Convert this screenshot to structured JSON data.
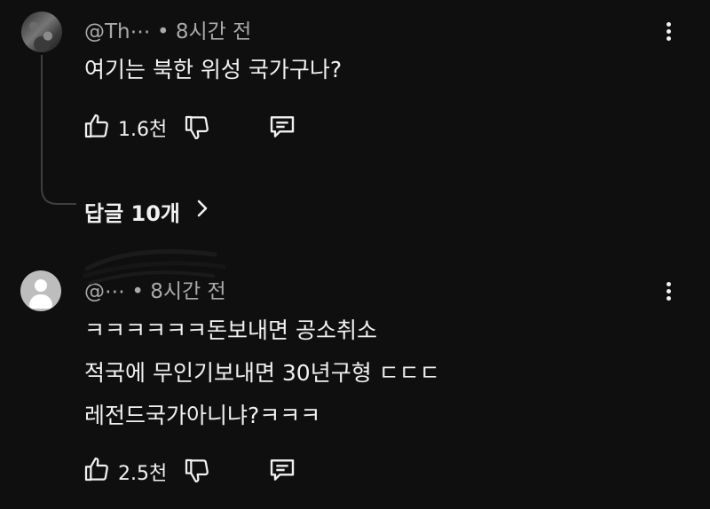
{
  "comments": [
    {
      "author": "@Th⋯",
      "time": "• 8시간 전",
      "lines": [
        "여기는  북한 위성 국가구나?"
      ],
      "likes": "1.6천",
      "replies_label": "답글 10개",
      "avatar": "photo-avatar"
    },
    {
      "author": "@⋯",
      "time": "• 8시간 전",
      "lines": [
        "ㅋㅋㅋㅋㅋㅋ돈보내면 공소취소",
        "적국에 무인기보내면 30년구형 ㄷㄷㄷ",
        "레전드국가아니냐?ㅋㅋㅋ"
      ],
      "likes": "2.5천",
      "avatar": "default-avatar"
    }
  ],
  "icons": {
    "like": "thumbs-up-icon",
    "dislike": "thumbs-down-icon",
    "reply": "reply-icon",
    "more": "more-vertical-icon",
    "chevron": "chevron-right-icon"
  },
  "colors": {
    "background": "#0f0f0f",
    "text": "#f1f1f1",
    "meta": "#aaaaaa"
  }
}
